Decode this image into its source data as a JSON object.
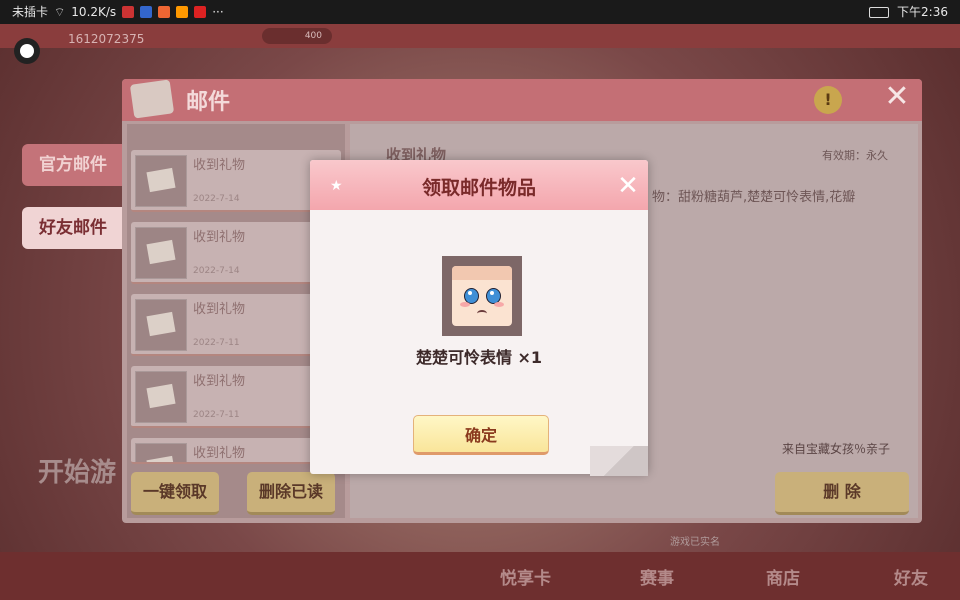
{
  "status_bar": {
    "carrier": "未插卡",
    "speed": "10.2K/s",
    "more": "···",
    "time": "下午2:36"
  },
  "game": {
    "player_id": "1612072375",
    "coin_value": "400",
    "start_text": "开始游",
    "side_tabs": [
      {
        "label": "官方邮件",
        "active": false
      },
      {
        "label": "好友邮件",
        "active": true
      }
    ],
    "bottom_note": "游戏已实名",
    "nav": [
      "悦享卡",
      "赛事",
      "商店",
      "好友"
    ]
  },
  "mail": {
    "title": "邮件",
    "list": [
      {
        "subject": "收到礼物",
        "date": "2022-7-14"
      },
      {
        "subject": "收到礼物",
        "date": "2022-7-14"
      },
      {
        "subject": "收到礼物",
        "date": "2022-7-11"
      },
      {
        "subject": "收到礼物",
        "date": "2022-7-11"
      },
      {
        "subject": "收到礼物",
        "date": ""
      }
    ],
    "detail": {
      "subject": "收到礼物",
      "validity": "有效期：永久",
      "body": "物：甜粉糖葫芦,楚楚可怜表情,花瓣",
      "from": "来自宝藏女孩％亲子"
    },
    "buttons": {
      "claim_all": "一键领取",
      "delete_read": "删除已读",
      "delete": "删 除"
    }
  },
  "modal": {
    "title": "领取邮件物品",
    "item_name": "楚楚可怜表情 ×1",
    "confirm": "确定"
  },
  "colors": {
    "modal_header": "#f4a6ad",
    "confirm_bg": "#f9e59a",
    "confirm_text": "#8a3a1e"
  }
}
